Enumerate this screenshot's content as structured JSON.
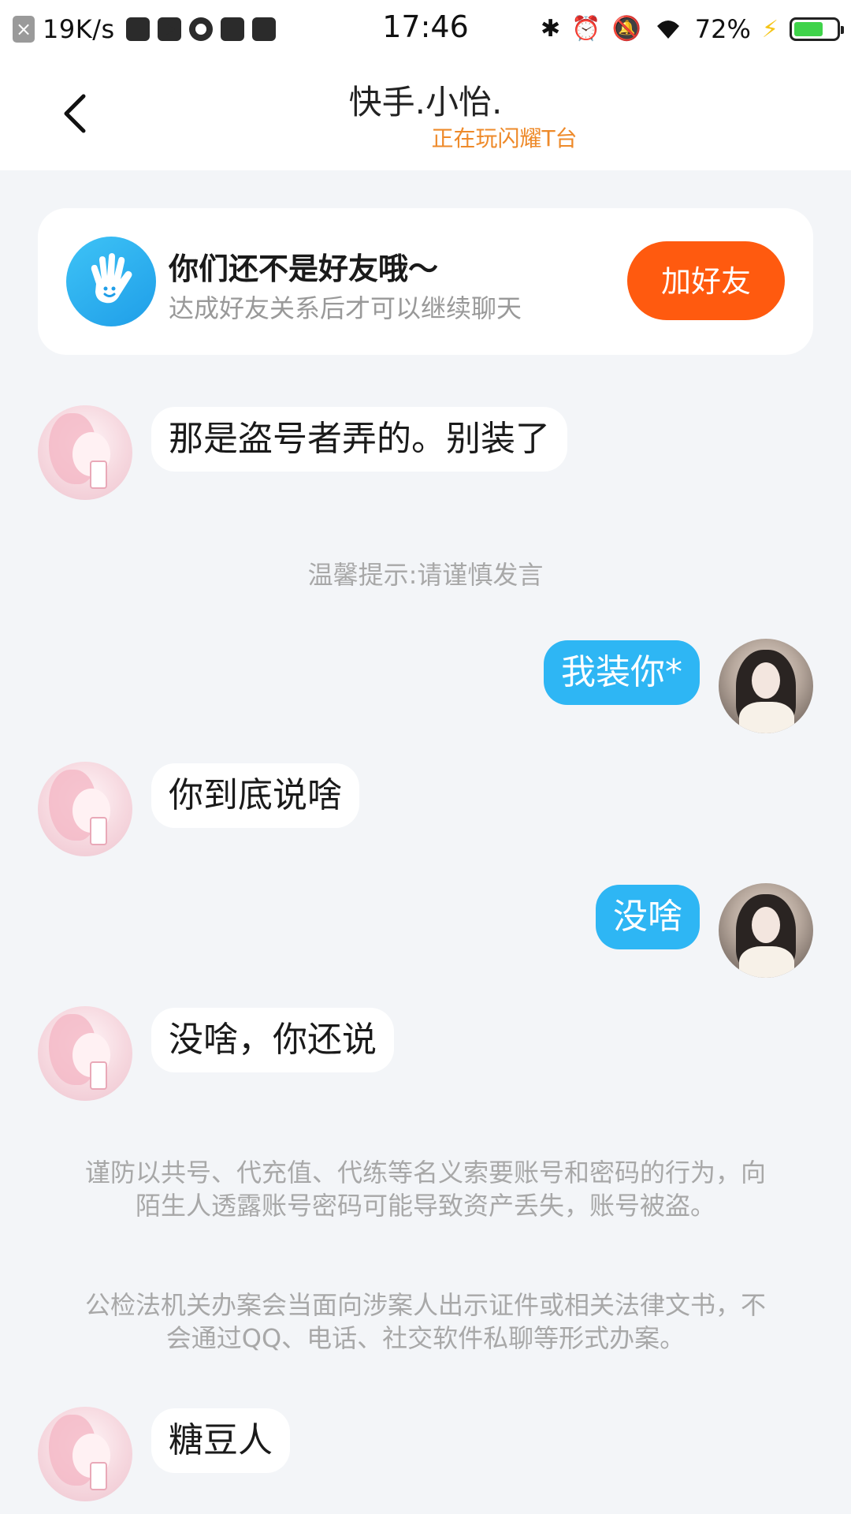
{
  "status_bar": {
    "net_speed": "19K/s",
    "time": "17:46",
    "battery_pct": "72%",
    "battery_level": 0.72,
    "icons": [
      "close-x-icon",
      "app-icon",
      "play-icon",
      "planet-icon",
      "mail-icon",
      "database-icon",
      "bluetooth-icon",
      "alarm-icon",
      "mute-bell-icon",
      "wifi-icon",
      "charging-bolt-icon",
      "battery-icon"
    ]
  },
  "nav": {
    "title": "快手.小怡.",
    "subtitle": "正在玩闪耀T台"
  },
  "friend_card": {
    "title": "你们还不是好友哦～",
    "description": "达成好友关系后才可以继续聊天",
    "add_button": "加好友"
  },
  "messages": [
    {
      "side": "in",
      "text": "那是盗号者弄的。别装了"
    },
    {
      "side": "tip",
      "text": "温馨提示:请谨慎发言"
    },
    {
      "side": "out",
      "text": "我装你*"
    },
    {
      "side": "in",
      "text": "你到底说啥"
    },
    {
      "side": "out",
      "text": "没啥"
    },
    {
      "side": "in",
      "text": "没啥，你还说"
    },
    {
      "side": "in",
      "text": "糖豆人"
    }
  ],
  "notices": [
    "谨防以共号、代充值、代练等名义索要账号和密码的行为，向陌生人透露账号密码可能导致资产丢失，账号被盗。",
    "公检法机关办案会当面向涉案人出示证件或相关法律文书，不会通过QQ、电话、社交软件私聊等形式办案。"
  ],
  "colors": {
    "background": "#f3f5f8",
    "outgoing_bubble": "#2eb6f4",
    "add_button": "#ff5a0f",
    "subtitle": "#ee8a2a"
  }
}
